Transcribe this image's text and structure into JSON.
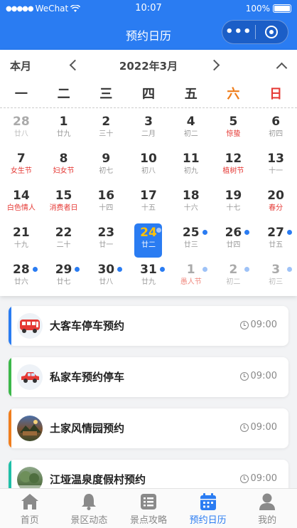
{
  "status_bar": {
    "carrier": "WeChat",
    "time": "10:07",
    "battery": "100%"
  },
  "navbar": {
    "title": "预约日历",
    "more_label": "•••"
  },
  "calendar": {
    "view_mode": "本月",
    "month_title": "2022年3月",
    "weekdays": [
      "一",
      "二",
      "三",
      "四",
      "五",
      "六",
      "日"
    ],
    "today": 24,
    "days": [
      {
        "num": "28",
        "sub": "廿八",
        "other": true
      },
      {
        "num": "1",
        "sub": "廿九"
      },
      {
        "num": "2",
        "sub": "三十"
      },
      {
        "num": "3",
        "sub": "二月"
      },
      {
        "num": "4",
        "sub": "初二"
      },
      {
        "num": "5",
        "sub": "惊蛰",
        "fest": true
      },
      {
        "num": "6",
        "sub": "初四"
      },
      {
        "num": "7",
        "sub": "女生节",
        "fest": true
      },
      {
        "num": "8",
        "sub": "妇女节",
        "fest": true
      },
      {
        "num": "9",
        "sub": "初七"
      },
      {
        "num": "10",
        "sub": "初八"
      },
      {
        "num": "11",
        "sub": "初九"
      },
      {
        "num": "12",
        "sub": "植树节",
        "fest": true
      },
      {
        "num": "13",
        "sub": "十一"
      },
      {
        "num": "14",
        "sub": "白色情人",
        "fest": true
      },
      {
        "num": "15",
        "sub": "消费者日",
        "fest": true
      },
      {
        "num": "16",
        "sub": "十四"
      },
      {
        "num": "17",
        "sub": "十五"
      },
      {
        "num": "18",
        "sub": "十六"
      },
      {
        "num": "19",
        "sub": "十七"
      },
      {
        "num": "20",
        "sub": "春分",
        "fest": true
      },
      {
        "num": "21",
        "sub": "十九"
      },
      {
        "num": "22",
        "sub": "二十"
      },
      {
        "num": "23",
        "sub": "廿一"
      },
      {
        "num": "24",
        "sub": "廿二",
        "dot": true,
        "today": true
      },
      {
        "num": "25",
        "sub": "廿三",
        "dot": true
      },
      {
        "num": "26",
        "sub": "廿四",
        "dot": true
      },
      {
        "num": "27",
        "sub": "廿五",
        "dot": true
      },
      {
        "num": "28",
        "sub": "廿六",
        "dot": true
      },
      {
        "num": "29",
        "sub": "廿七",
        "dot": true
      },
      {
        "num": "30",
        "sub": "廿八",
        "dot": true
      },
      {
        "num": "31",
        "sub": "廿九",
        "dot": true
      },
      {
        "num": "1",
        "sub": "愚人节",
        "fest": true,
        "other": true,
        "dot": true
      },
      {
        "num": "2",
        "sub": "初二",
        "other": true,
        "dot": true
      },
      {
        "num": "3",
        "sub": "初三",
        "other": true,
        "dot": true
      }
    ]
  },
  "appointments": [
    {
      "name": "大客车停车预约",
      "time": "09:00",
      "color": "#2a7cf2",
      "icon": "bus-icon"
    },
    {
      "name": "私家车预约停车",
      "time": "09:00",
      "color": "#3cb84a",
      "icon": "car-icon"
    },
    {
      "name": "土家风情园预约",
      "time": "09:00",
      "color": "#f07e1e",
      "icon": "scenic-photo-icon"
    },
    {
      "name": "江垭温泉度假村预约",
      "time": "09:00",
      "color": "#1fbfa8",
      "icon": "resort-photo-icon"
    }
  ],
  "tabbar": {
    "items": [
      {
        "label": "首页",
        "icon": "home-icon"
      },
      {
        "label": "景区动态",
        "icon": "bell-icon"
      },
      {
        "label": "景点攻略",
        "icon": "guide-list-icon"
      },
      {
        "label": "预约日历",
        "icon": "calendar-icon",
        "active": true
      },
      {
        "label": "我的",
        "icon": "user-icon"
      }
    ]
  }
}
